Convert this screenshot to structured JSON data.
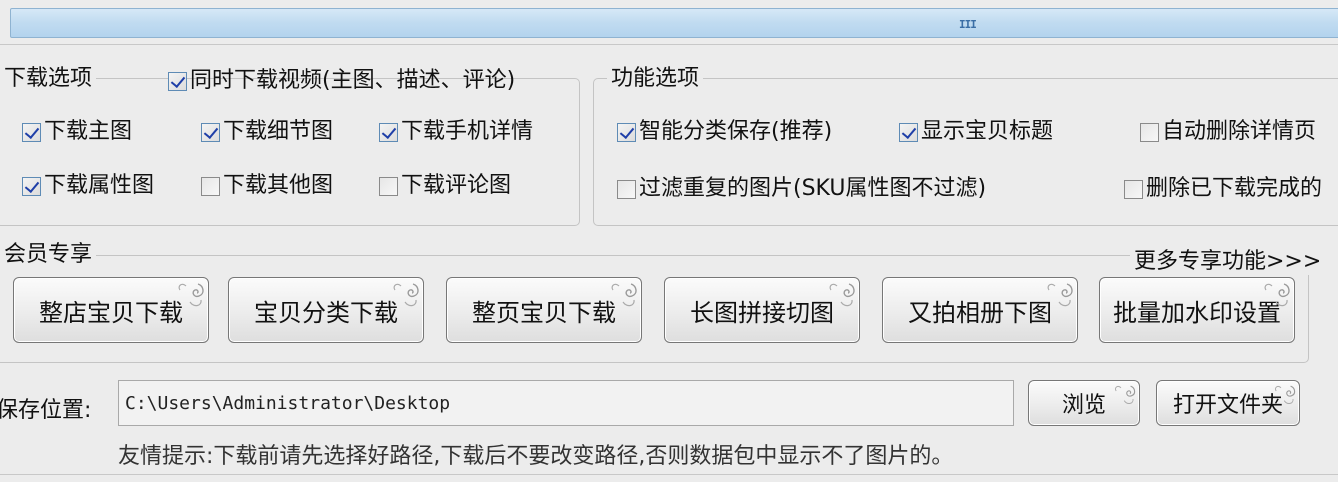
{
  "scrollbar": {
    "grip": "III"
  },
  "download_options": {
    "title": "下载选项",
    "header_checkbox": {
      "label": "同时下载视频(主图、描述、评论)",
      "checked": true
    },
    "items": [
      {
        "label": "下载主图",
        "checked": true
      },
      {
        "label": "下载细节图",
        "checked": true
      },
      {
        "label": "下载手机详情",
        "checked": true
      },
      {
        "label": "下载属性图",
        "checked": true
      },
      {
        "label": "下载其他图",
        "checked": false
      },
      {
        "label": "下载评论图",
        "checked": false
      }
    ]
  },
  "function_options": {
    "title": "功能选项",
    "items": [
      {
        "label": "智能分类保存(推荐)",
        "checked": true
      },
      {
        "label": "显示宝贝标题",
        "checked": true
      },
      {
        "label": "自动删除详情页",
        "checked": false
      },
      {
        "label": "过滤重复的图片(SKU属性图不过滤)",
        "checked": false
      },
      {
        "label": "删除已下载完成的",
        "checked": false
      }
    ]
  },
  "vip": {
    "title": "会员专享",
    "more_link": "更多专享功能>>>",
    "buttons": [
      "整店宝贝下载",
      "宝贝分类下载",
      "整页宝贝下载",
      "长图拼接切图",
      "又拍相册下图",
      "批量加水印设置"
    ]
  },
  "save": {
    "label": "保存位置:",
    "path": "C:\\Users\\Administrator\\Desktop",
    "browse": "浏览",
    "open_folder": "打开文件夹"
  },
  "hint": "友情提示:下载前请先选择好路径,下载后不要改变路径,否则数据包中显示不了图片的。"
}
